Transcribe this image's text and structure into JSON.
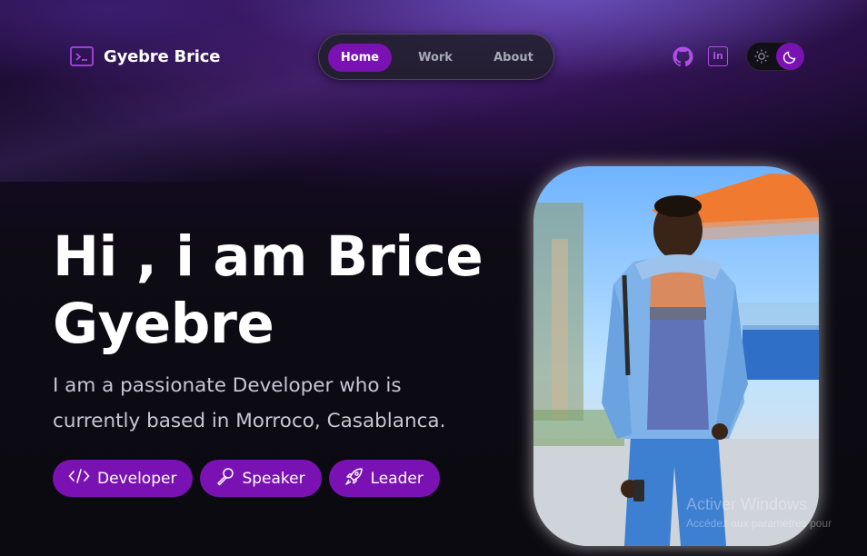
{
  "header": {
    "brand_name": "Gyebre Brice",
    "brand_icon": "terminal-icon",
    "nav": [
      {
        "label": "Home",
        "active": true
      },
      {
        "label": "Work",
        "active": false
      },
      {
        "label": "About",
        "active": false
      }
    ],
    "social": [
      "github-icon",
      "linkedin-icon"
    ],
    "linkedin_text": "in",
    "theme_toggle": {
      "icons": [
        "sun-icon",
        "moon-icon"
      ],
      "mode": "dark"
    }
  },
  "hero": {
    "title_line1": "Hi , i am Brice",
    "title_line2": "Gyebre",
    "subtitle_line1": "I am a passionate Developer who is",
    "subtitle_line2": "currently based in Morroco, Casablanca.",
    "tags": [
      {
        "label": "Developer",
        "icon": "code-icon"
      },
      {
        "label": "Speaker",
        "icon": "microphone-icon"
      },
      {
        "label": "Leader",
        "icon": "rocket-icon"
      }
    ]
  },
  "os_watermark": {
    "line1": "Activer Windows",
    "line2": "Accédez aux paramètres pour"
  },
  "colors": {
    "accent": "#7a12b3",
    "accent_light": "#b04ee6",
    "background": "#0b0a10"
  }
}
